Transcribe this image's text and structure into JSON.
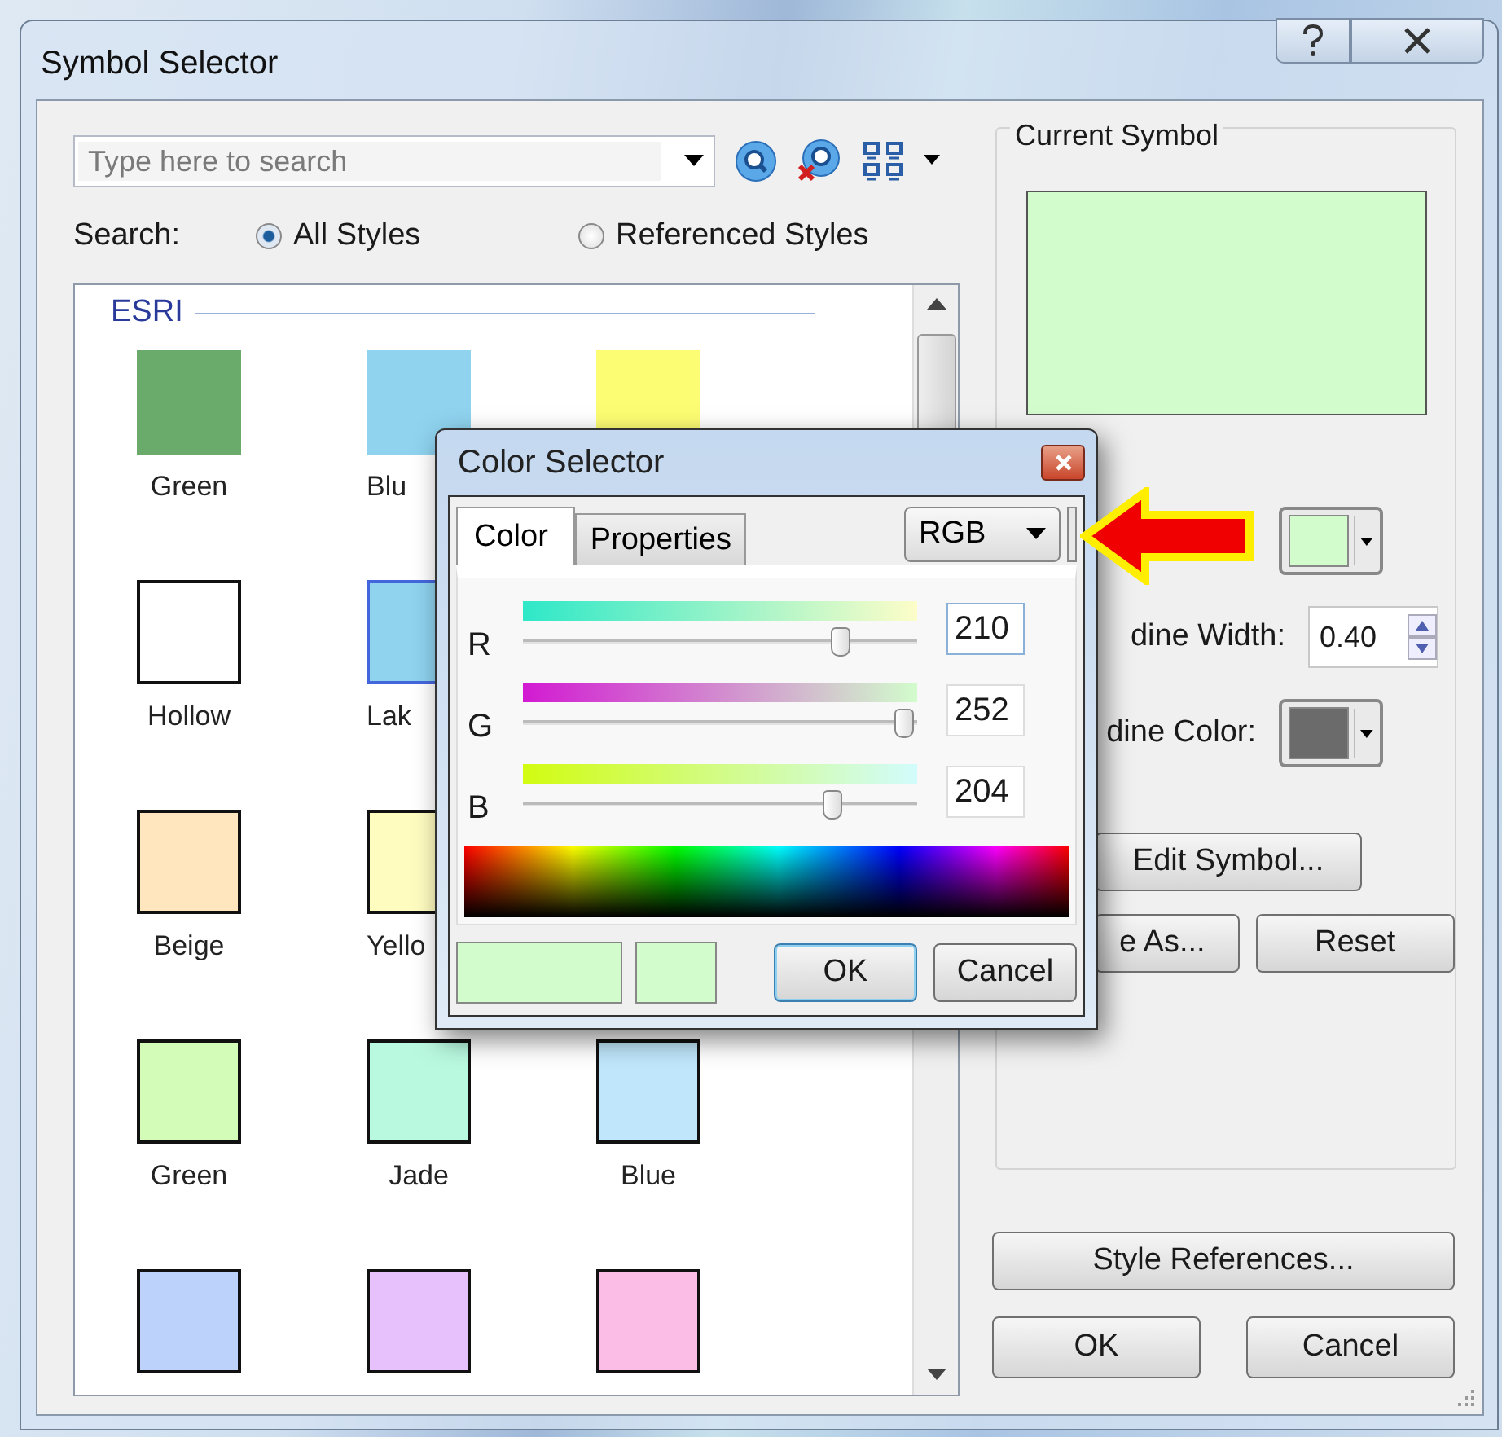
{
  "window": {
    "title": "Symbol Selector"
  },
  "search": {
    "placeholder": "Type here to search"
  },
  "search_scope": {
    "label": "Search:",
    "options": [
      {
        "label": "All Styles",
        "selected": true
      },
      {
        "label": "Referenced Styles",
        "selected": false
      }
    ]
  },
  "symbol_list": {
    "group": "ESRI",
    "rows": [
      [
        {
          "label": "Green",
          "color": "#6aaa6a",
          "outlined": false,
          "selected": false
        },
        {
          "label": "Blu",
          "color": "#8fd3ef",
          "outlined": false,
          "selected": false
        },
        {
          "color": "#fdfd73",
          "outlined": false,
          "selected": false
        }
      ],
      [
        {
          "label": "Hollow",
          "color": "#ffffff",
          "outlined": true,
          "selected": false
        },
        {
          "label": "Lak",
          "color": "#8fd3ef",
          "outlined": true,
          "selected": true
        }
      ],
      [
        {
          "label": "Beige",
          "color": "#ffe6bf",
          "outlined": true,
          "selected": false
        },
        {
          "label": "Yello",
          "color": "#fffcc0",
          "outlined": true,
          "selected": false
        }
      ],
      [
        {
          "label": "Green",
          "color": "#d3fcb8",
          "outlined": true,
          "selected": false
        },
        {
          "label": "Jade",
          "color": "#b9f9e0",
          "outlined": true,
          "selected": false
        },
        {
          "label": "Blue",
          "color": "#bfe6fb",
          "outlined": true,
          "selected": false
        }
      ],
      [
        {
          "color": "#bdd2fb",
          "outlined": true,
          "selected": false
        },
        {
          "color": "#e6c1fb",
          "outlined": true,
          "selected": false
        },
        {
          "color": "#fbbde6",
          "outlined": true,
          "selected": false
        }
      ]
    ]
  },
  "current_symbol": {
    "title": "Current Symbol"
  },
  "outline_width": {
    "label": "dine Width:",
    "value": "0.40"
  },
  "outline_color": {
    "label": "dine Color:"
  },
  "buttons": {
    "edit_symbol": "Edit Symbol...",
    "save_as": "e As...",
    "reset": "Reset",
    "style_references": "Style References...",
    "ok": "OK",
    "cancel": "Cancel"
  },
  "color_selector": {
    "title": "Color Selector",
    "tabs": [
      {
        "label": "Color",
        "selected": true
      },
      {
        "label": "Properties",
        "selected": false
      }
    ],
    "model": "RGB",
    "channels": [
      {
        "name": "R",
        "level": 0.82,
        "value": "210"
      },
      {
        "name": "G",
        "level": 0.99,
        "value": "252"
      },
      {
        "name": "B",
        "level": 0.8,
        "value": "204"
      }
    ],
    "buttons": [
      "OK",
      "Cancel"
    ]
  }
}
